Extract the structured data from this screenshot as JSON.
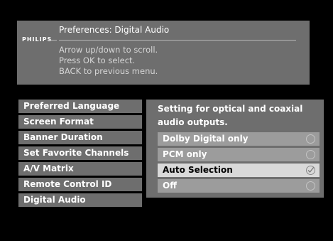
{
  "header": {
    "brand": "PHILIPS",
    "title": "Preferences: Digital Audio",
    "instructions": [
      "Arrow up/down to scroll.",
      "Press OK to select.",
      "BACK to previous menu."
    ]
  },
  "menu": {
    "items": [
      {
        "label": "Preferred Language"
      },
      {
        "label": "Screen Format"
      },
      {
        "label": "Banner Duration"
      },
      {
        "label": "Set Favorite Channels"
      },
      {
        "label": "A/V Matrix"
      },
      {
        "label": "Remote Control ID"
      },
      {
        "label": "Digital Audio"
      }
    ],
    "selected": "Digital Audio"
  },
  "panel": {
    "description": "Setting for optical and coaxial audio outputs.",
    "options": [
      {
        "label": "Dolby Digital only",
        "checked": false
      },
      {
        "label": "PCM only",
        "checked": false
      },
      {
        "label": "Auto Selection",
        "checked": true
      },
      {
        "label": "Off",
        "checked": false
      }
    ]
  },
  "icons": {
    "radio_unchecked": "radio-unchecked-icon",
    "radio_checked": "radio-checked-icon"
  },
  "colors": {
    "background": "#000000",
    "panel": "#6e6e6e",
    "option": "#9c9c9c",
    "option_selected": "#d9d9d9"
  }
}
